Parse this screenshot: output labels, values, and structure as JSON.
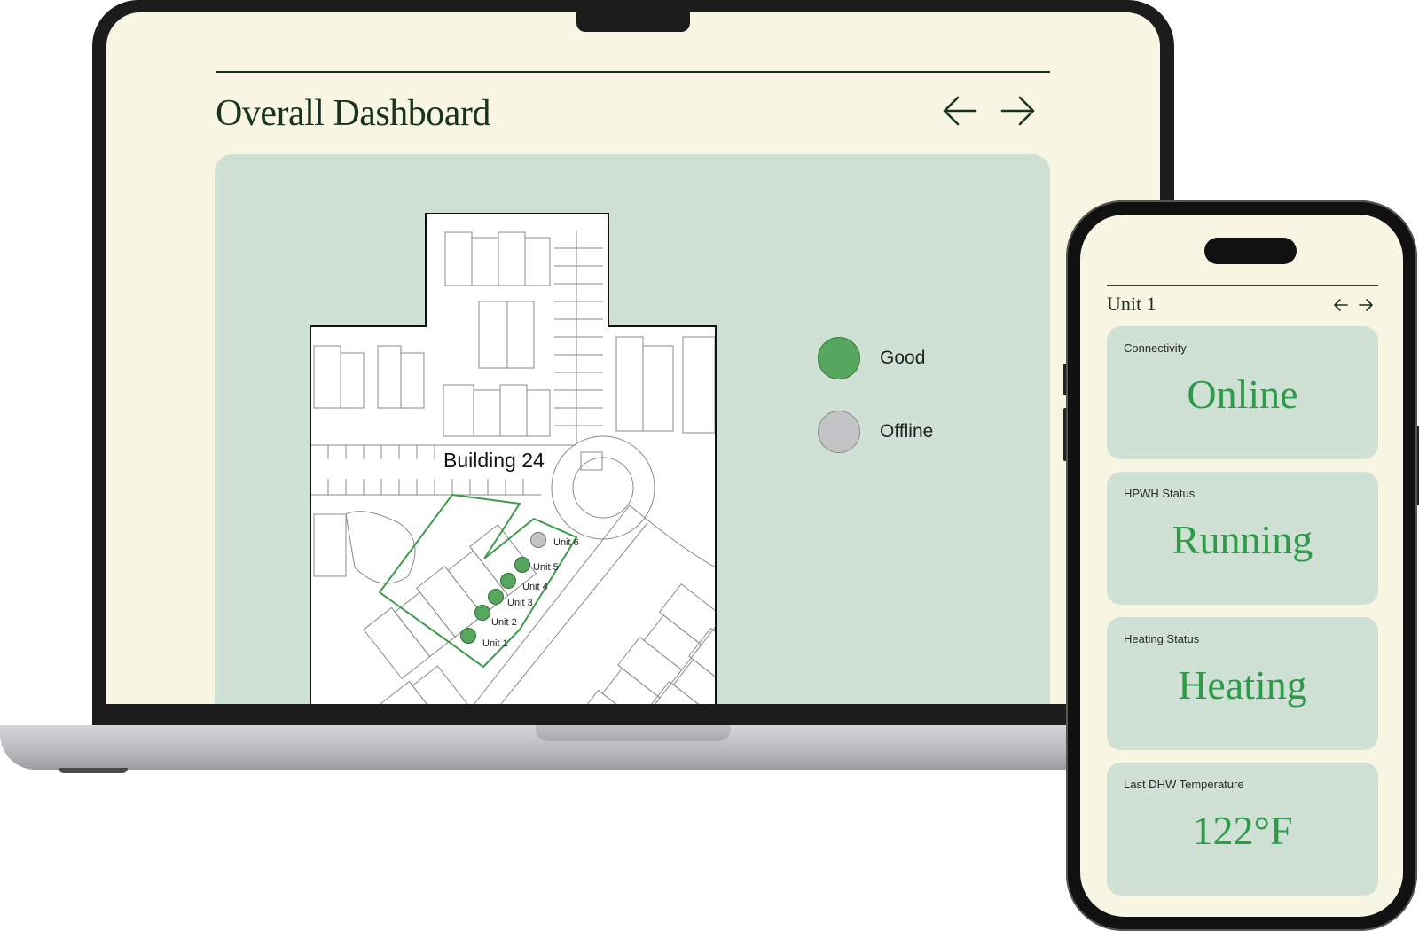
{
  "dashboard": {
    "title": "Overall Dashboard",
    "building_label": "Building 24",
    "legend": [
      {
        "label": "Good",
        "color": "#57a65f"
      },
      {
        "label": "Offline",
        "color": "#c4c4c6"
      }
    ],
    "units": [
      {
        "label": "Unit 1",
        "status": "good"
      },
      {
        "label": "Unit 2",
        "status": "good"
      },
      {
        "label": "Unit 3",
        "status": "good"
      },
      {
        "label": "Unit 4",
        "status": "good"
      },
      {
        "label": "Unit 5",
        "status": "good"
      },
      {
        "label": "Unit 6",
        "status": "offline"
      }
    ],
    "nav_icons": [
      "arrow-left-icon",
      "arrow-right-icon"
    ]
  },
  "mobile": {
    "title": "Unit 1",
    "cards": [
      {
        "label": "Connectivity",
        "value": "Online"
      },
      {
        "label": "HPWH Status",
        "value": "Running"
      },
      {
        "label": "Heating Status",
        "value": "Heating"
      },
      {
        "label": "Last DHW Temperature",
        "value": "122°F"
      }
    ]
  },
  "colors": {
    "background": "#f8f5e3",
    "panel": "#cfe0d4",
    "accent_dark": "#17331f",
    "status_green": "#2f9a4a",
    "good": "#57a65f",
    "offline": "#c4c4c6"
  }
}
